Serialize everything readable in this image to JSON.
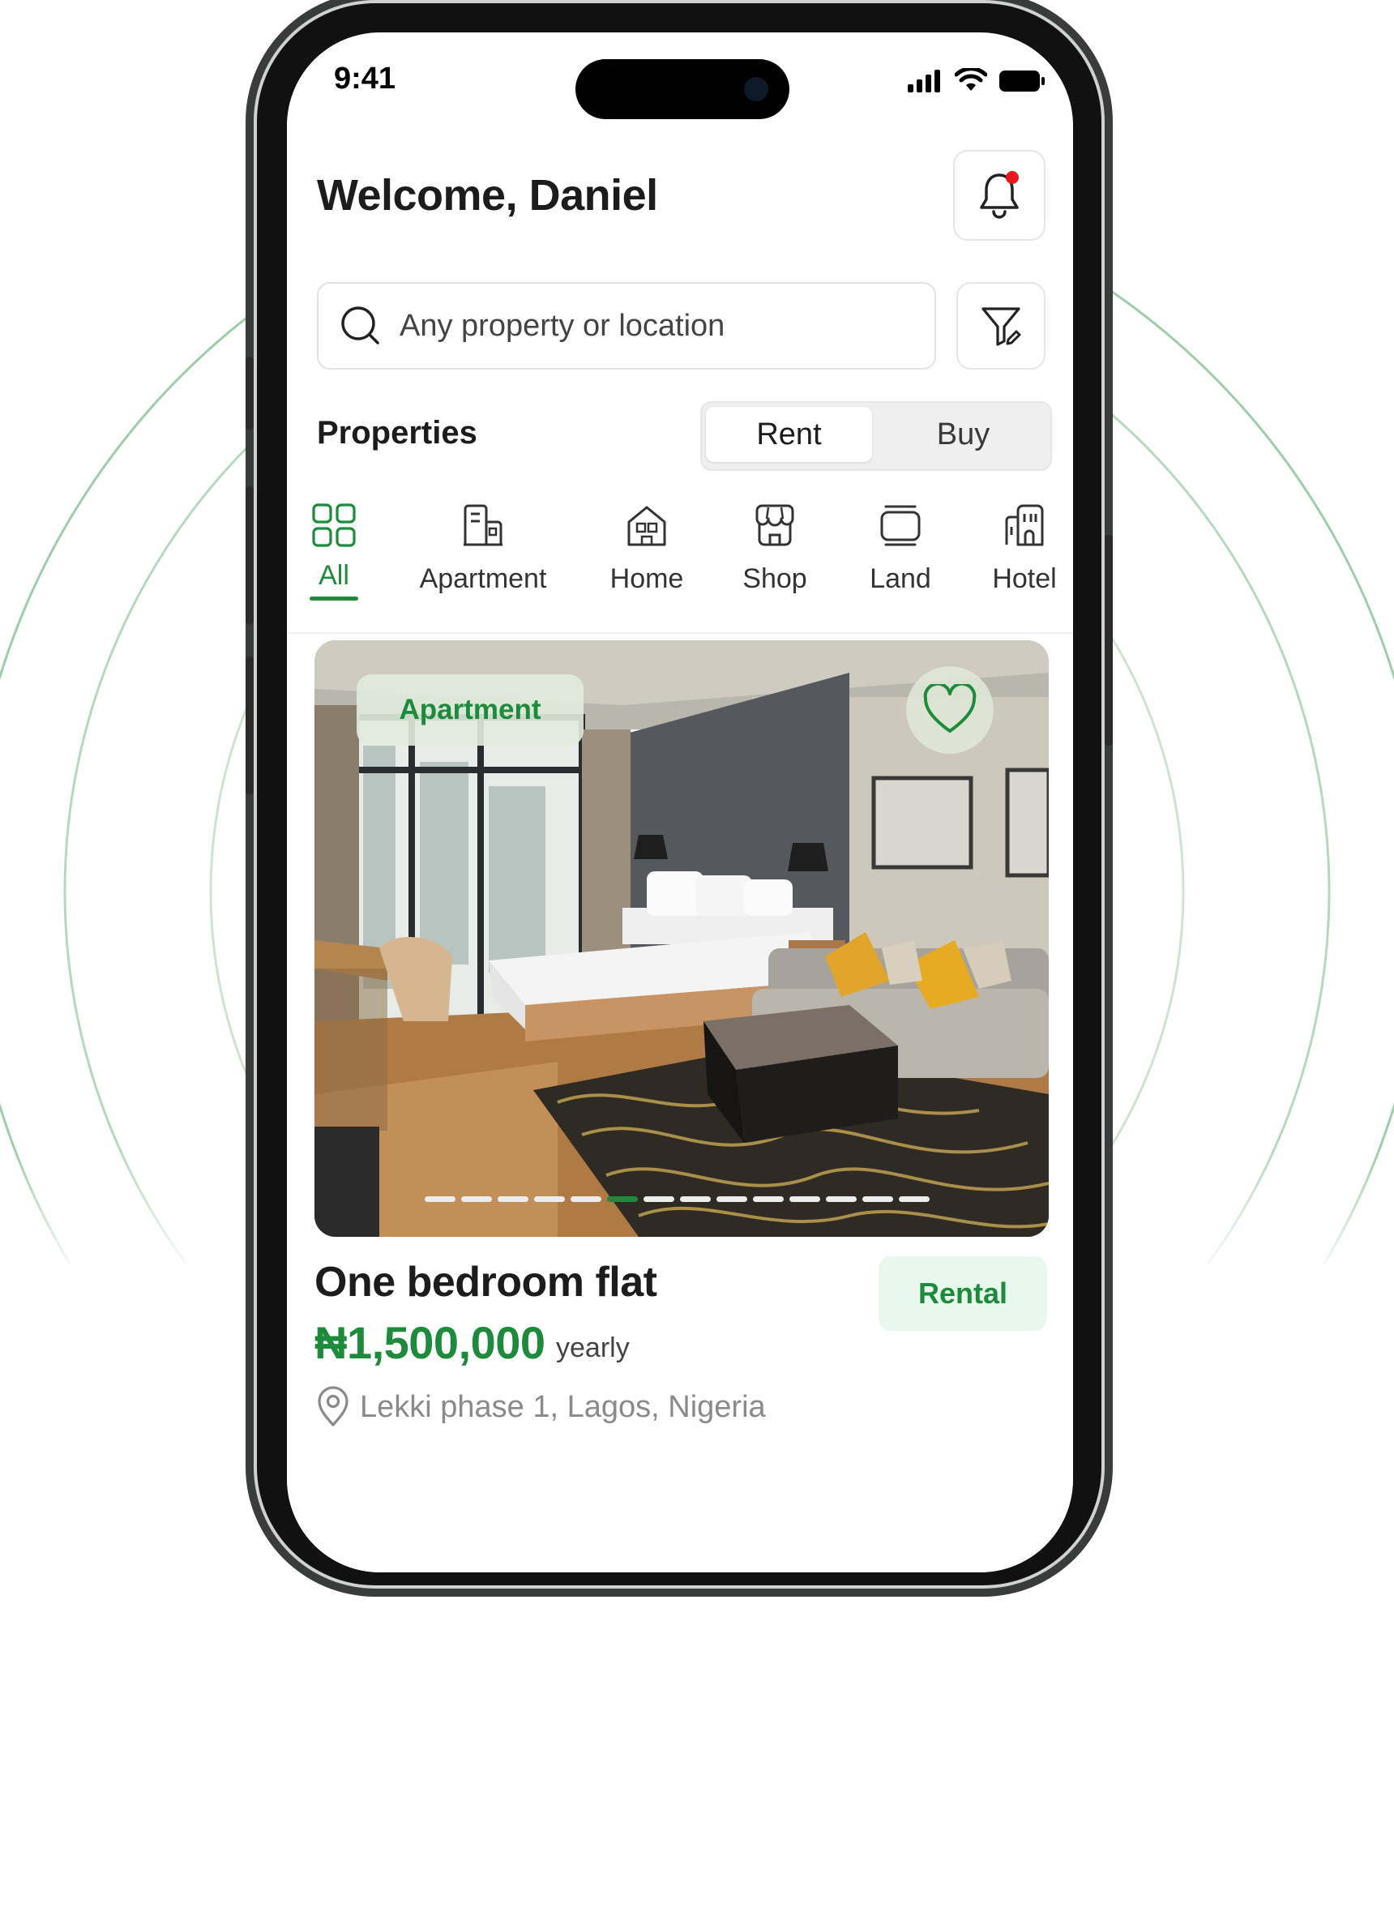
{
  "status_bar": {
    "time": "9:41"
  },
  "header": {
    "welcome": "Welcome, Daniel"
  },
  "search": {
    "placeholder": "Any property or location"
  },
  "properties": {
    "title": "Properties",
    "toggle": {
      "selected": "Rent",
      "options": [
        "Rent",
        "Buy"
      ]
    }
  },
  "categories": {
    "selected": "All",
    "items": [
      {
        "label": "All",
        "icon": "grid-icon"
      },
      {
        "label": "Apartment",
        "icon": "apartment-icon"
      },
      {
        "label": "Home",
        "icon": "home-icon"
      },
      {
        "label": "Shop",
        "icon": "shop-icon"
      },
      {
        "label": "Land",
        "icon": "land-icon"
      },
      {
        "label": "Hotel",
        "icon": "hotel-icon"
      }
    ]
  },
  "listing": {
    "tag": "Apartment",
    "title": "One bedroom flat",
    "badge": "Rental",
    "price": "₦1,500,000",
    "period": "yearly",
    "location": "Lekki phase 1, Lagos, Nigeria",
    "carousel": {
      "total": 14,
      "active_index": 5
    }
  },
  "colors": {
    "accent": "#1d8a3c",
    "notification_dot": "#e5191e",
    "badge_bg": "#e8f8ec"
  }
}
